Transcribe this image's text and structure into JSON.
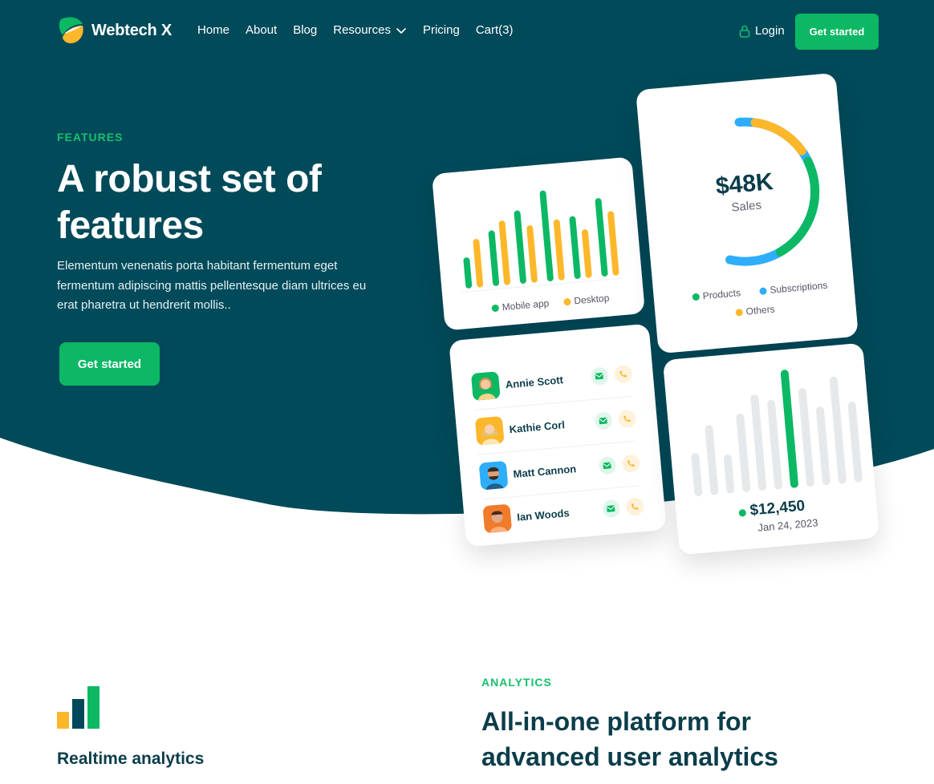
{
  "nav": {
    "brand": "Webtech X",
    "menu": [
      "Home",
      "About",
      "Blog",
      "Resources",
      "Pricing",
      "Cart(3)"
    ],
    "login": "Login",
    "cta": "Get started"
  },
  "hero": {
    "eyebrow": "FEATURES",
    "title": "A robust set of features",
    "description": "Elementum venenatis porta habitant fermentum eget fermentum adipiscing mattis pellentesque diam ultrices eu erat pharetra ut hendrerit mollis..",
    "cta": "Get started"
  },
  "cards": {
    "bars": {
      "legend": [
        "Mobile app",
        "Desktop"
      ],
      "mobile_values": [
        0.28,
        0.56,
        0.76,
        0.96,
        0.64,
        0.82
      ],
      "desktop_values": [
        0.48,
        0.66,
        0.58,
        0.62,
        0.48,
        0.66
      ]
    },
    "donut": {
      "value": "$48K",
      "label": "Sales",
      "legend": [
        "Products",
        "Subscriptions",
        "Others"
      ]
    },
    "contacts": {
      "people": [
        {
          "name": "Annie Scott"
        },
        {
          "name": "Kathie Corl"
        },
        {
          "name": "Matt Cannon"
        },
        {
          "name": "Ian Woods"
        }
      ]
    },
    "revenue": {
      "value": "$12,450",
      "date": "Jan 24, 2023",
      "bars": [
        0.32,
        0.56,
        0.28,
        0.64,
        0.8,
        0.74,
        1.0,
        0.82,
        0.64,
        0.9,
        0.66
      ]
    }
  },
  "features": {
    "feature_title": "Realtime analytics",
    "eyebrow": "ANALYTICS",
    "title": "All-in-one platform for advanced user analytics"
  },
  "colors": {
    "primary": "#0cb864",
    "navy": "#004a5a",
    "yellow": "#fdb72a",
    "blue": "#2eadfb"
  }
}
